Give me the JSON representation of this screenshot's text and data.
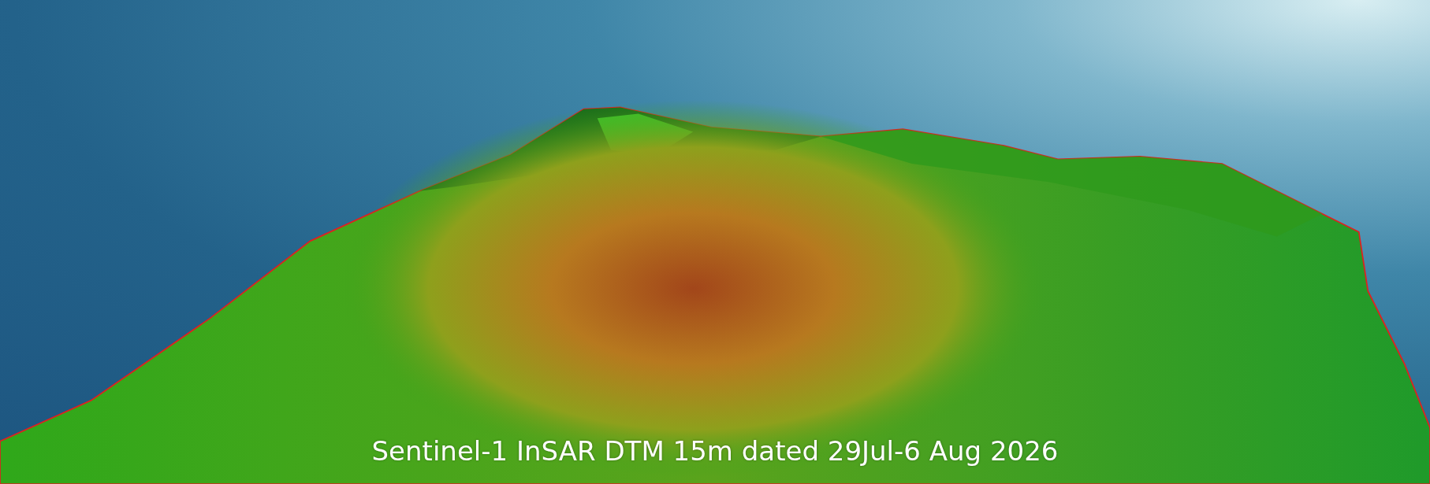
{
  "caption": "Sentinel-1 InSAR DTM 15m dated 29Jul-6 Aug 2026"
}
